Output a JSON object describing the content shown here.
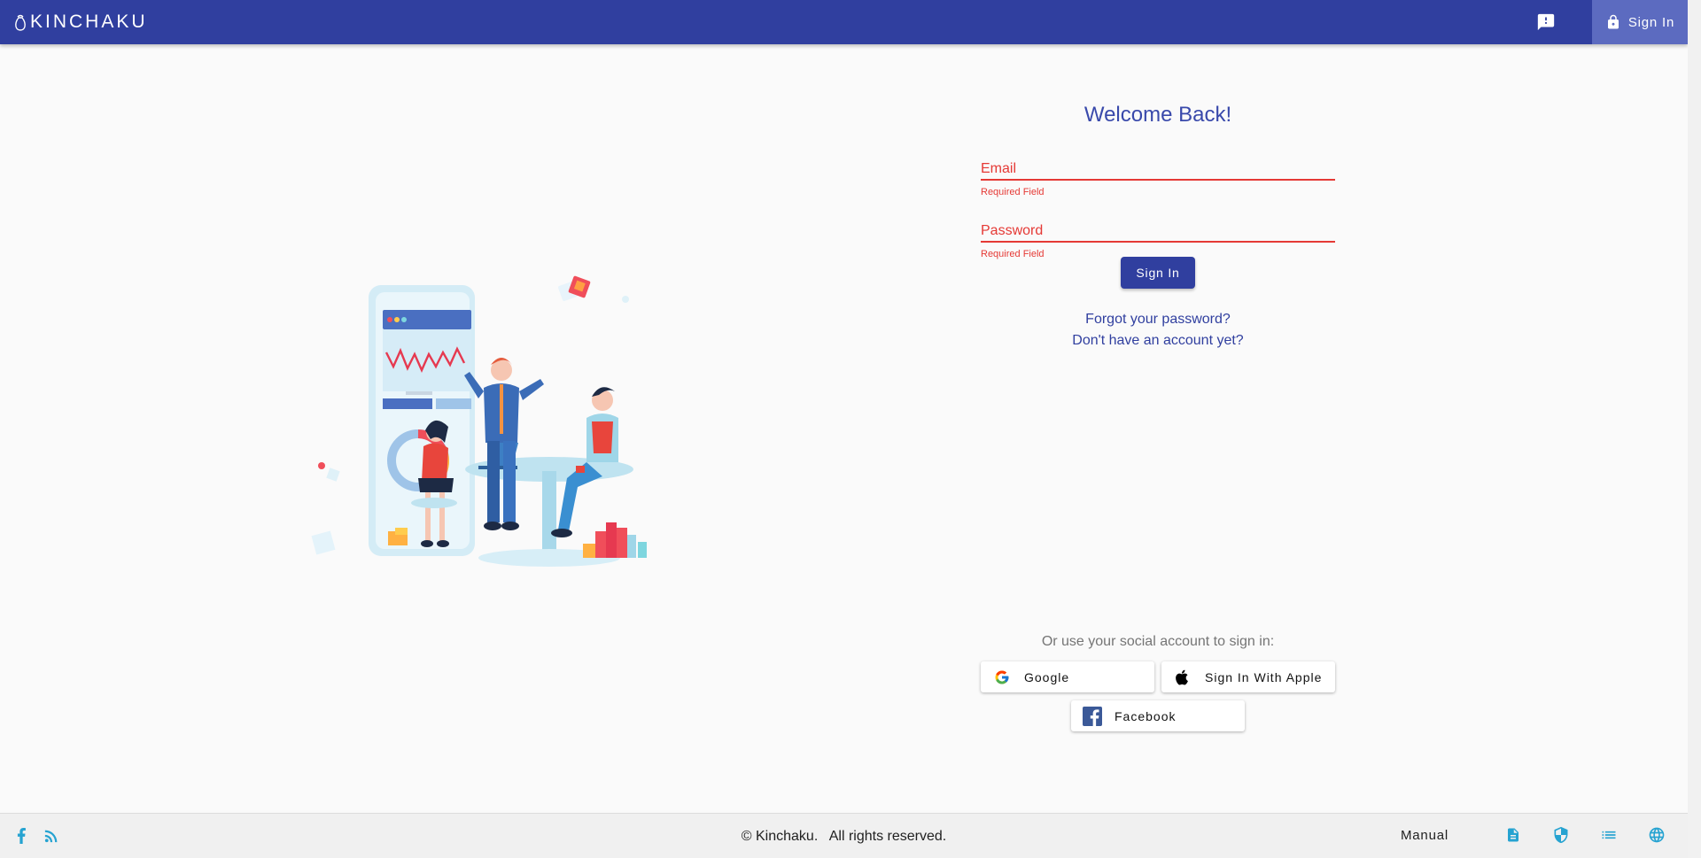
{
  "header": {
    "brand": "KINCHAKU",
    "signin_label": "Sign In"
  },
  "login": {
    "title": "Welcome Back!",
    "email_label": "Email",
    "email_error": "Required Field",
    "password_label": "Password",
    "password_error": "Required Field",
    "submit_label": "Sign In",
    "forgot_link": "Forgot your password?",
    "register_link": "Don't have an account yet?"
  },
  "social": {
    "title": "Or use your social account to sign in:",
    "google_label": "Google",
    "apple_label": "Sign In With Apple",
    "facebook_label": "Facebook"
  },
  "footer": {
    "copyright": "© Kinchaku.   All rights reserved.",
    "manual_label": "Manual"
  },
  "colors": {
    "primary": "#303f9f",
    "primary_light": "#5c6bc0",
    "error": "#e53935",
    "footer_icon": "#26a3d1"
  }
}
